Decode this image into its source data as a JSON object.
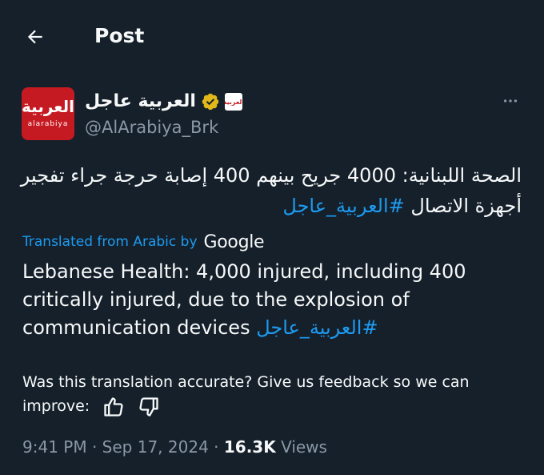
{
  "header": {
    "title": "Post"
  },
  "author": {
    "display_name": "العربية عاجل",
    "handle": "@AlArabiya_Brk",
    "avatar_text_ar": "العربية",
    "avatar_text_en": "alarabiya",
    "affiliate_badge_text": "العربية"
  },
  "tweet": {
    "original_text": "الصحة اللبنانية: 4000 جريح بينهم 400 إصابة حرجة جراء تفجير أجهزة الاتصال",
    "original_hashtag": "#العربية_عاجل",
    "translated_label": "Translated from Arabic by",
    "translator": "Google",
    "translated_text": "Lebanese Health: 4,000 injured, including 400 critically injured, due to the explosion of communication devices",
    "translated_hashtag": "#العربية_عاجل"
  },
  "feedback": {
    "question": "Was this translation accurate? Give us feedback so we can improve:"
  },
  "meta": {
    "time": "9:41 PM",
    "separator1": "·",
    "date": "Sep 17, 2024",
    "separator2": "·",
    "views_count": "16.3K",
    "views_label": "Views"
  },
  "icons": {
    "back": "arrow-left-icon",
    "verified": "verified-gold-badge-icon",
    "more": "more-horizontal-icon",
    "thumbs_up": "thumbs-up-icon",
    "thumbs_down": "thumbs-down-icon"
  },
  "colors": {
    "background": "#15202b",
    "text": "#f7f9f9",
    "secondary": "#8b98a5",
    "link": "#1d9bf0",
    "verified_gold": "#e2b719",
    "brand_red": "#c61a22"
  }
}
